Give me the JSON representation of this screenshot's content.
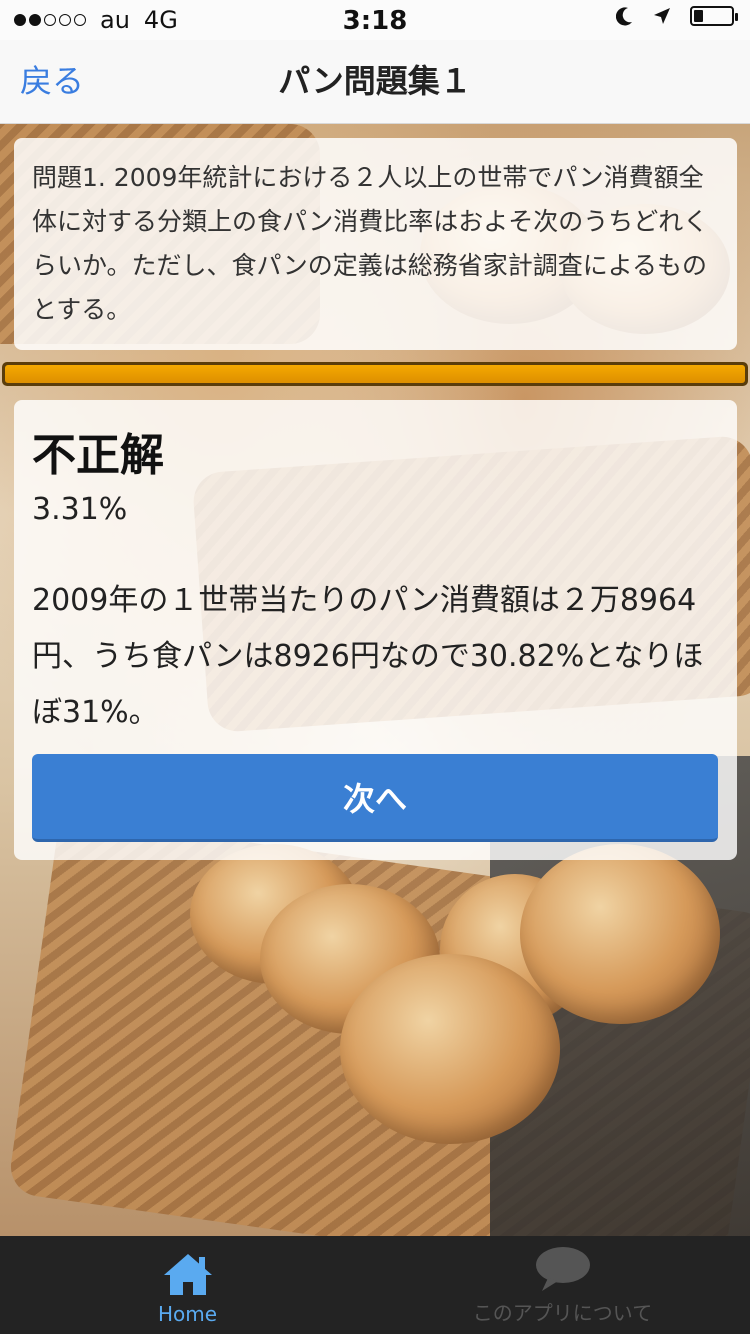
{
  "status_bar": {
    "carrier": "au",
    "network": "4G",
    "time": "3:18",
    "signal_filled": 2,
    "signal_total": 5,
    "battery_level": 0.25
  },
  "nav": {
    "back_label": "戻る",
    "title": "パン問題集１"
  },
  "question": {
    "text": "問題1. 2009年統計における２人以上の世帯でパン消費額全体に対する分類上の食パン消費比率はおよそ次のうちどれくらいか。ただし、食パンの定義は総務省家計調査によるものとする。"
  },
  "progress": {
    "value": 1.0,
    "color": "#f5a900"
  },
  "result": {
    "title": "不正解",
    "percent": "3.31%",
    "explanation": "2009年の１世帯当たりのパン消費額は２万8964円、うち食パンは8926円なので30.82%となりほぼ31%。",
    "next_label": "次へ"
  },
  "tab_bar": {
    "tabs": [
      {
        "label": "Home",
        "icon": "home-icon",
        "active": true
      },
      {
        "label": "このアプリについて",
        "icon": "speech-bubble-icon",
        "active": false
      }
    ],
    "accent_color": "#5aaaf0"
  }
}
